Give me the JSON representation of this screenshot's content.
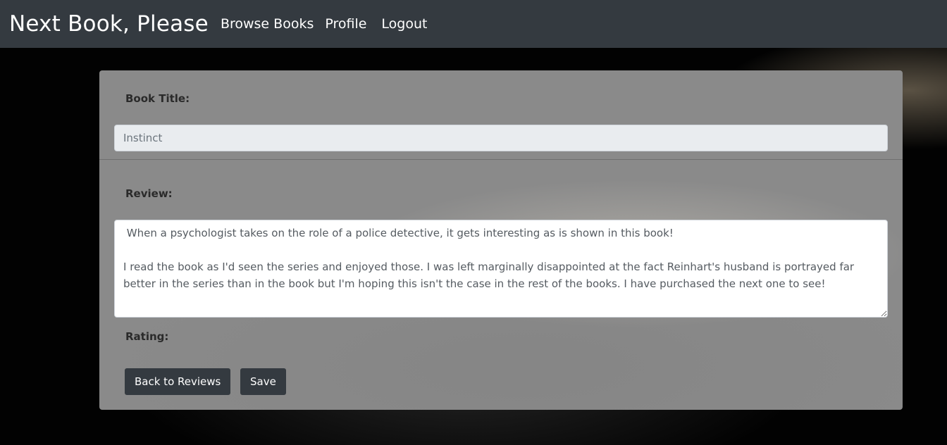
{
  "navbar": {
    "brand": "Next Book, Please",
    "links": [
      {
        "label": "Browse Books"
      },
      {
        "label": "Profile"
      },
      {
        "label": "Logout"
      }
    ]
  },
  "form": {
    "book_title_label": "Book Title:",
    "book_title_value": "Instinct",
    "review_label": "Review:",
    "review_value": " When a psychologist takes on the role of a police detective, it gets interesting as is shown in this book!\n\nI read the book as I'd seen the series and enjoyed those. I was left marginally disappointed at the fact Reinhart's husband is portrayed far better in the series than in the book but I'm hoping this isn't the case in the rest of the books. I have purchased the next one to see!",
    "rating_label": "Rating:",
    "back_button": "Back to Reviews",
    "save_button": "Save"
  },
  "colors": {
    "navbar_bg": "#343a40",
    "button_bg": "#343a40",
    "card_bg": "#8a8a8a",
    "page_bg": "#000000"
  }
}
